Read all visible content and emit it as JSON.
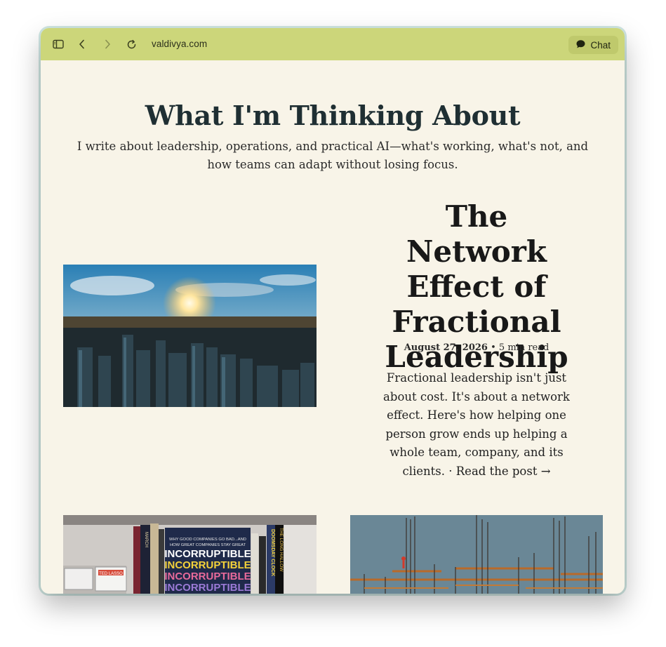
{
  "browser": {
    "url": "valdivya.com",
    "chat_label": "Chat",
    "icons": [
      "sidebar-icon",
      "back-icon",
      "forward-icon",
      "reload-icon",
      "chat-bubble-icon"
    ]
  },
  "page": {
    "title": "What I'm Thinking About",
    "subtitle": "I write about leadership, operations, and practical AI—what's working, what's not, and how teams can adapt without losing focus."
  },
  "featured_post": {
    "title": "The Network Effect of Fractional Leadership",
    "date": "August 27, 2026",
    "separator": "•",
    "read_time": "5 min read",
    "excerpt": "Fractional leadership isn't just about cost. It's about a network effect. Here's how helping one person grow ends up helping a whole team, company, and its clients. ·",
    "read_more": "Read the post →"
  },
  "more_posts": {
    "book_cover_lines": [
      "WHY GOOD COMPANIES GO BAD...AND",
      "HOW GREAT COMPANIES STAY GREAT",
      "INCORRUPTIBLE"
    ],
    "book_spines": [
      "MARCH",
      "DOOMSDAY CLOCK",
      "THE LONG HALLOW"
    ],
    "figure_boxes": [
      "TED LASSO"
    ]
  },
  "colors": {
    "toolbar": "#ccd67a",
    "page_bg": "#f8f4e8",
    "title": "#1f2f33"
  }
}
